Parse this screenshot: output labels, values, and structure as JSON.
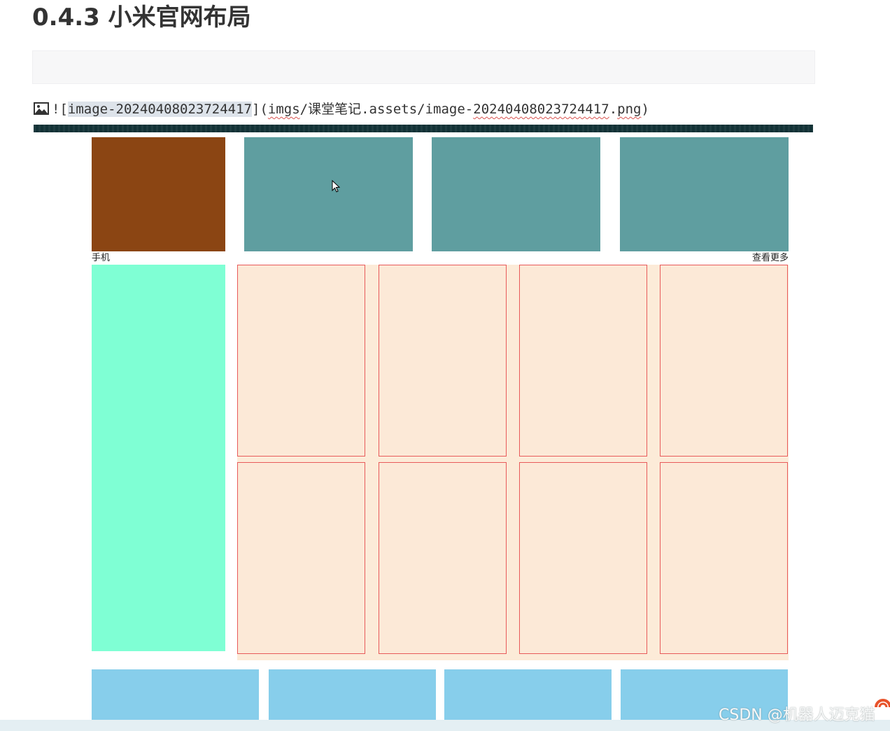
{
  "heading": "0.4.3 小米官网布局",
  "markdown_line": {
    "prefix": "![",
    "selected": "image-20240408023724417",
    "mid": "](",
    "path_a": "imgs",
    "path_b": "/课堂笔记.assets/image-",
    "path_c": "20240408023724417",
    "path_d": ".",
    "path_e": "png",
    "suffix": ")"
  },
  "layout_labels": {
    "left": "手机",
    "right": "查看更多"
  },
  "watermark": "CSDN @机器人迈克猫",
  "colors": {
    "brown": "#8b4513",
    "teal": "#5f9ea0",
    "aquamarine": "#7fffd4",
    "peach": "#fce9d7",
    "cell_border": "#e85a5a",
    "skyblue": "#87ceeb"
  },
  "icons": {
    "image_icon": "image-icon",
    "cursor": "mouse-cursor-icon",
    "logo": "csdn-logo-icon"
  }
}
